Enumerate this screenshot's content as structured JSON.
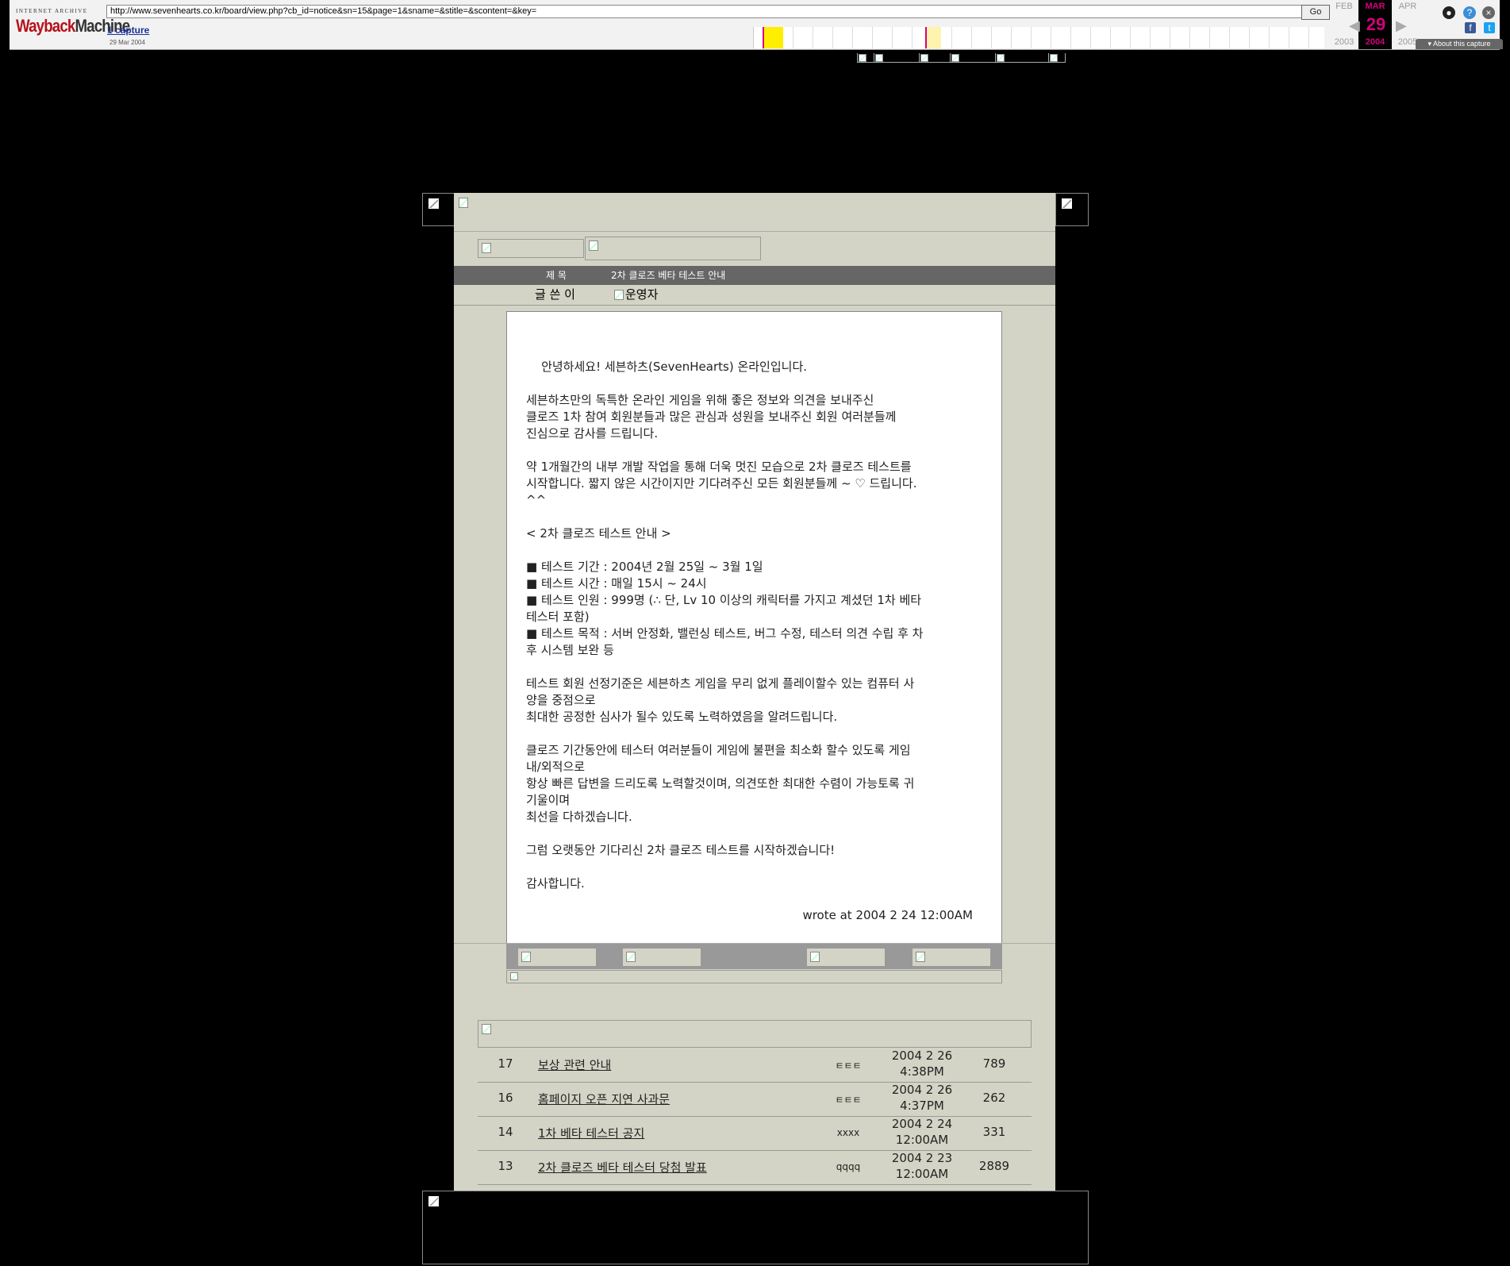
{
  "wayback": {
    "logo_top": "INTERNET ARCHIVE",
    "logo_way": "Wayback",
    "logo_machine": "Machine",
    "url": "http://www.sevenhearts.co.kr/board/view.php?cb_id=notice&sn=15&page=1&sname=&stitle=&scontent=&key=",
    "go_label": "Go",
    "captures_label": "1 capture",
    "capture_date": "29 Mar 2004",
    "prev_month": "FEB",
    "cur_month": "MAR",
    "next_month": "APR",
    "cur_day": "29",
    "prev_year": "2003",
    "cur_year": "2004",
    "next_year": "2005",
    "about_label": "About this capture",
    "accent_color": "#d4007a"
  },
  "post": {
    "title_label": "제 목",
    "title": "2차 클로즈 베타 테스트 안내",
    "author_label": "글 쓴 이",
    "author": "운영자",
    "body": "안녕하세요! 세븐하츠(SevenHearts) 온라인입니다.\n\n세븐하츠만의 독특한 온라인 게임을 위해 좋은 정보와 의견을 보내주신\n클로즈 1차 참여 회원분들과 많은 관심과 성원을 보내주신 회원 여러분들께\n진심으로 감사를 드립니다.\n\n약 1개월간의 내부 개발 작업을 통해 더욱 멋진 모습으로 2차 클로즈 테스트를\n시작합니다. 짧지 않은 시간이지만 기다려주신 모든 회원분들께 ~ ♡ 드립니다.\n^^\n\n< 2차 클로즈 테스트 안내 >\n\n■ 테스트 기간 : 2004년 2월 25일 ~ 3월 1일\n■ 테스트 시간 : 매일 15시 ~ 24시\n■ 테스트 인원 : 999명 (∴ 단, Lv 10 이상의 캐릭터를 가지고 계셨던 1차 베타\n테스터 포함)\n■ 테스트 목적 : 서버 안정화, 밸런싱 테스트, 버그 수정, 테스터 의견 수립 후 차\n후 시스템 보완 등\n\n테스트 회원 선정기준은 세븐하츠 게임을 무리 없게 플레이할수 있는 컴퓨터 사\n양을 중점으로\n최대한 공정한 심사가 될수 있도록 노력하였음을 알려드립니다.\n\n클로즈 기간동안에 테스터 여러분들이 게임에 불편을 최소화 할수 있도록 게임\n내/외적으로\n항상 빠른 답변을 드리도록 노력할것이며, 의견또한 최대한 수렴이 가능토록 귀\n기울이며\n최선을 다하겠습니다.\n\n그럼 오랫동안 기다리신 2차 클로즈 테스트를 시작하겠습니다!\n\n감사합니다.",
    "wrote": "wrote at 2004 2 24 12:00AM"
  },
  "list": [
    {
      "no": "17",
      "subject": "보상 관련 안내",
      "author": "ㅌㅌㅌ",
      "date1": "2004 2 26",
      "date2": "4:38PM",
      "hits": "789"
    },
    {
      "no": "16",
      "subject": "홈페이지 오픈 지연 사과문",
      "author": "ㅌㅌㅌ",
      "date1": "2004 2 26",
      "date2": "4:37PM",
      "hits": "262"
    },
    {
      "no": "14",
      "subject": "1차 베타 테스터 공지",
      "author": "xxxx",
      "date1": "2004 2 24",
      "date2": "12:00AM",
      "hits": "331"
    },
    {
      "no": "13",
      "subject": "2차 클로즈 베타 테스터 당첨 발표",
      "author": "qqqq",
      "date1": "2004 2 23",
      "date2": "12:00AM",
      "hits": "2889"
    }
  ]
}
